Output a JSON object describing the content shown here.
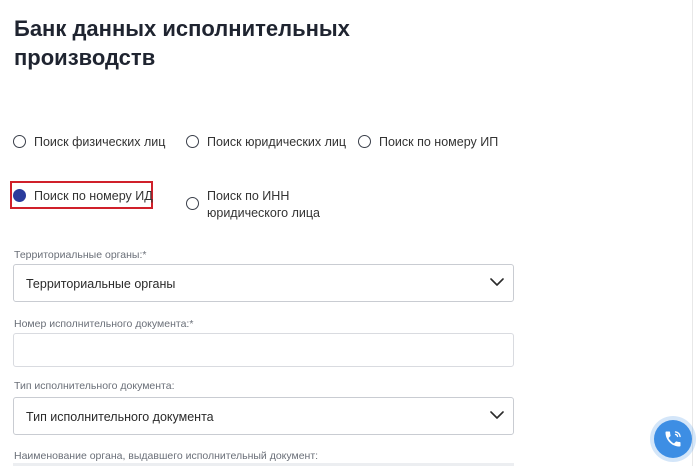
{
  "page": {
    "title": "Банк данных исполнительных\nпроизводств"
  },
  "search_types": {
    "selected": "Поиск по номеру ИД",
    "options": [
      {
        "label": "Поиск физических лиц",
        "checked": false
      },
      {
        "label": "Поиск юридических лиц",
        "checked": false
      },
      {
        "label": "Поиск по номеру ИП",
        "checked": false
      },
      {
        "label": "Поиск по номеру ИД",
        "checked": true
      },
      {
        "label": "Поиск по ИНН\nюридического лица",
        "checked": false
      }
    ]
  },
  "form": {
    "territorial": {
      "label": "Территориальные органы:*",
      "value": "Территориальные органы"
    },
    "doc_number": {
      "label": "Номер исполнительного документа:*",
      "value": ""
    },
    "doc_type": {
      "label": "Тип исполнительного документа:",
      "value": "Тип исполнительного документа"
    },
    "issuer": {
      "label": "Наименование органа, выдавшего исполнительный документ:"
    }
  },
  "icons": {
    "chevron": "chevron-down-icon",
    "call": "phone-call-icon"
  },
  "colors": {
    "radio_selected": "#2a3b9c",
    "highlight": "#d0202a",
    "call_button": "#3d8ee4"
  }
}
